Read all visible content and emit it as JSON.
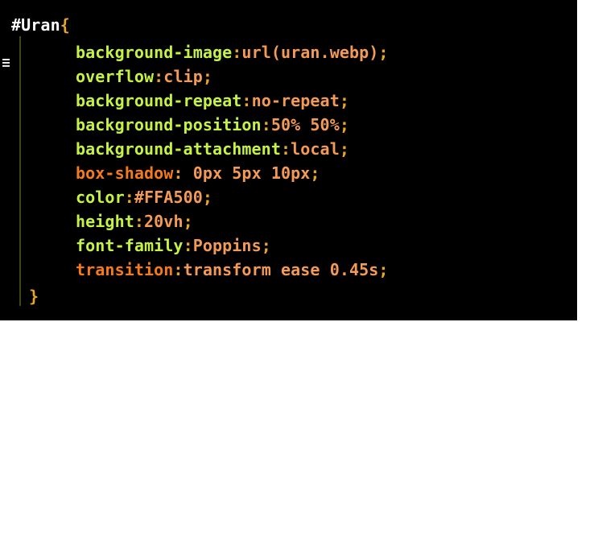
{
  "editor": {
    "selector": "#Uran",
    "open_brace": "{",
    "close_brace": "}",
    "declarations": [
      {
        "property": "background-image",
        "value": "url(uran.webp)"
      },
      {
        "property": "overflow",
        "value": "clip"
      },
      {
        "property": "background-repeat",
        "value": "no-repeat"
      },
      {
        "property": "background-position",
        "value": "50% 50%"
      },
      {
        "property": "background-attachment",
        "value": "local"
      },
      {
        "property": "box-shadow",
        "value": " 0px 5px 10px"
      },
      {
        "property": "color",
        "value": "#FFA500"
      },
      {
        "property": "height",
        "value": "20vh"
      },
      {
        "property": "font-family",
        "value": "Poppins"
      },
      {
        "property": "transition",
        "value": "transform ease 0.45s"
      }
    ],
    "colors": {
      "background": "#000000",
      "property": "#c6f244",
      "property_highlight": "#f57a1c",
      "value": "#f49a57",
      "punctuation": "#e8a52a",
      "selector": "#ffffff"
    }
  }
}
